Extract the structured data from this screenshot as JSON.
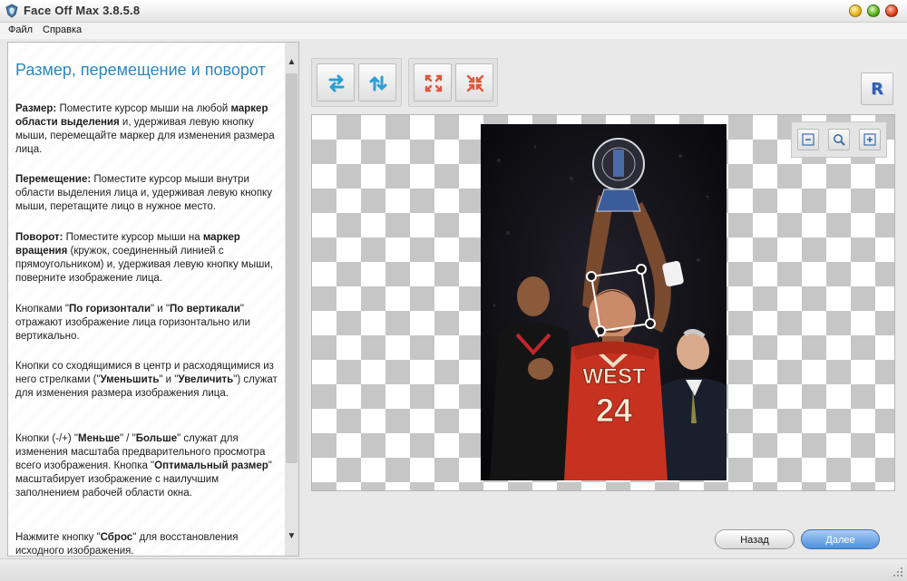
{
  "window": {
    "title": "Face Off Max  3.8.5.8"
  },
  "menu": {
    "file": "Файл",
    "help": "Справка"
  },
  "help": {
    "title": "Размер, перемещение и поворот",
    "p1": {
      "b1": "Размер:",
      "t1": " Поместите курсор мыши на любой ",
      "b2": "маркер области выделения",
      "t2": " и, удерживая левую кнопку мыши, перемещайте маркер для изменения размера лица."
    },
    "p2": {
      "b1": "Перемещение:",
      "t1": " Поместите курсор мыши внутри области выделения лица и, удерживая левую кнопку мыши, перетащите лицо в нужное место."
    },
    "p3": {
      "b1": "Поворот:",
      "t1": " Поместите курсор мыши на ",
      "b2": "маркер вращения",
      "t2": " (кружок, соединенный линией с прямоугольником) и, удерживая левую кнопку мыши, поверните изображение лица."
    },
    "p4": {
      "t1": "Кнопками \"",
      "b1": "По горизонтали",
      "t2": "\" и \"",
      "b2": "По вертикали",
      "t3": "\" отражают изображение лица горизонтально или вертикально."
    },
    "p5": {
      "t1": "Кнопки со сходящимися в центр и расходящимися из него стрелками (\"",
      "b1": "Уменьшить",
      "t2": "\" и \"",
      "b2": "Увеличить",
      "t3": "\") служат для изменения размера изображения лица."
    },
    "p6": {
      "t1": "Кнопки (-/+) \"",
      "b1": "Меньше",
      "t2": "\" / \"",
      "b2": "Больше",
      "t3": "\" служат для изменения масштаба предварительного просмотра всего изображения. Кнопка \"",
      "b3": "Оптимальный размер",
      "t4": "\" масштабирует изображение с наилучшим заполнением рабочей области окна."
    },
    "p7": {
      "t1": "Нажмите кнопку \"",
      "b1": "Сброс",
      "t2": "\" для восстановления исходного изображения."
    }
  },
  "toolbar": {
    "reset_glyph": "R"
  },
  "photo": {
    "jersey_team": "WEST",
    "jersey_number": "24"
  },
  "nav": {
    "back_label": "Назад",
    "next_label": "Далее"
  },
  "colors": {
    "accent_title": "#2b86bd",
    "next_button": "#4f8fdb",
    "flip_icon": "#2a9fd6",
    "resize_icon": "#e2553a"
  }
}
